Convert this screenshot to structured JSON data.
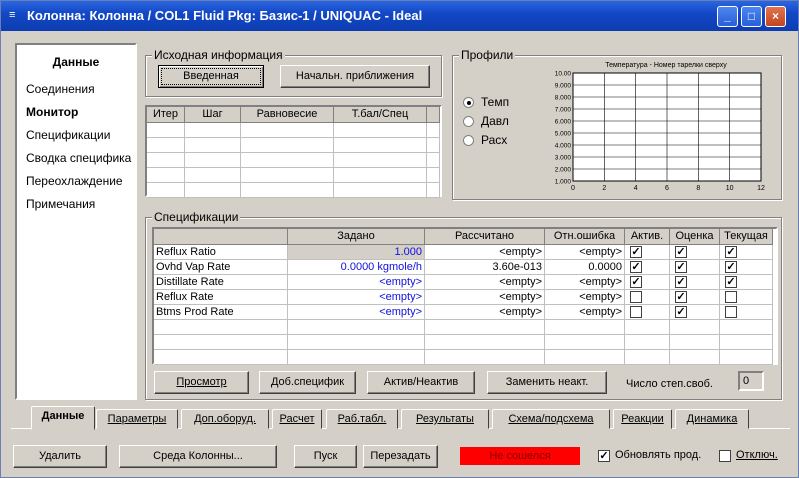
{
  "window": {
    "title": "Колонна: Колонна / COL1   Fluid Pkg: Базис-1 / UNIQUAC - Ideal",
    "title_icon": "column-icon",
    "controls": {
      "minimize": "_",
      "maximize": "□",
      "close": "×"
    }
  },
  "nav": {
    "header": "Данные",
    "items": [
      "Соединения",
      "Монитор",
      "Спецификации",
      "Сводка специфика",
      "Переохлаждение",
      "Примечания"
    ],
    "selected": "Монитор"
  },
  "source_info": {
    "legend": "Исходная информация",
    "button_entered": "Введенная",
    "button_initial": "Начальн. приближения"
  },
  "iter_table": {
    "headers": [
      "Итер",
      "Шаг",
      "Равновесие",
      "Т.бал/Спец"
    ]
  },
  "profiles": {
    "legend": "Профили",
    "options": [
      "Темп",
      "Давл",
      "Расх"
    ],
    "selected": "Темп"
  },
  "chart_data": {
    "type": "line",
    "title": "Температура - Номер тарелки сверху",
    "x_ticks": [
      "0",
      "2",
      "4",
      "6",
      "8",
      "10",
      "12"
    ],
    "y_ticks": [
      "1.000",
      "2.000",
      "3.000",
      "4.000",
      "5.000",
      "6.000",
      "7.000",
      "8.000",
      "9.000",
      "10.00"
    ],
    "xlim": [
      0,
      12
    ],
    "ylim": [
      1,
      10
    ],
    "grid": true,
    "series": []
  },
  "specs": {
    "legend": "Спецификации",
    "headers": [
      "",
      "Задано",
      "Рассчитано",
      "Отн.ошибка",
      "Актив.",
      "Оценка",
      "Текущая"
    ],
    "rows": [
      {
        "name": "Reflux Ratio",
        "specified": "1.000",
        "calculated": "<empty>",
        "error": "<empty>",
        "active": true,
        "estimate": true,
        "current": true
      },
      {
        "name": "Ovhd Vap Rate",
        "specified": "0.0000 kgmole/h",
        "calculated": "3.60e-013",
        "error": "0.0000",
        "active": true,
        "estimate": true,
        "current": true
      },
      {
        "name": "Distillate Rate",
        "specified": "<empty>",
        "calculated": "<empty>",
        "error": "<empty>",
        "active": true,
        "estimate": true,
        "current": true
      },
      {
        "name": "Reflux Rate",
        "specified": "<empty>",
        "calculated": "<empty>",
        "error": "<empty>",
        "active": false,
        "estimate": true,
        "current": false
      },
      {
        "name": "Btms Prod Rate",
        "specified": "<empty>",
        "calculated": "<empty>",
        "error": "<empty>",
        "active": false,
        "estimate": true,
        "current": false
      }
    ],
    "buttons": {
      "view": "Просмотр",
      "add": "Доб.специфик",
      "toggle": "Актив/Неактив",
      "replace": "Заменить неакт."
    },
    "dof_label": "Число степ.своб.",
    "dof_value": "0"
  },
  "tabs": [
    "Данные",
    "Параметры",
    "Доп.оборуд.",
    "Расчет",
    "Раб.табл.",
    "Результаты",
    "Схема/подсхема",
    "Реакции",
    "Динамика"
  ],
  "tab_active": "Данные",
  "bottom": {
    "delete": "Удалить",
    "env": "Среда Колонны...",
    "run": "Пуск",
    "reset": "Перезадать",
    "status": "Не сошелся",
    "status_color": "#ff0000",
    "update_label": "Обновлять прод.",
    "update_checked": true,
    "disable_label": "Отключ.",
    "disable_checked": false
  }
}
